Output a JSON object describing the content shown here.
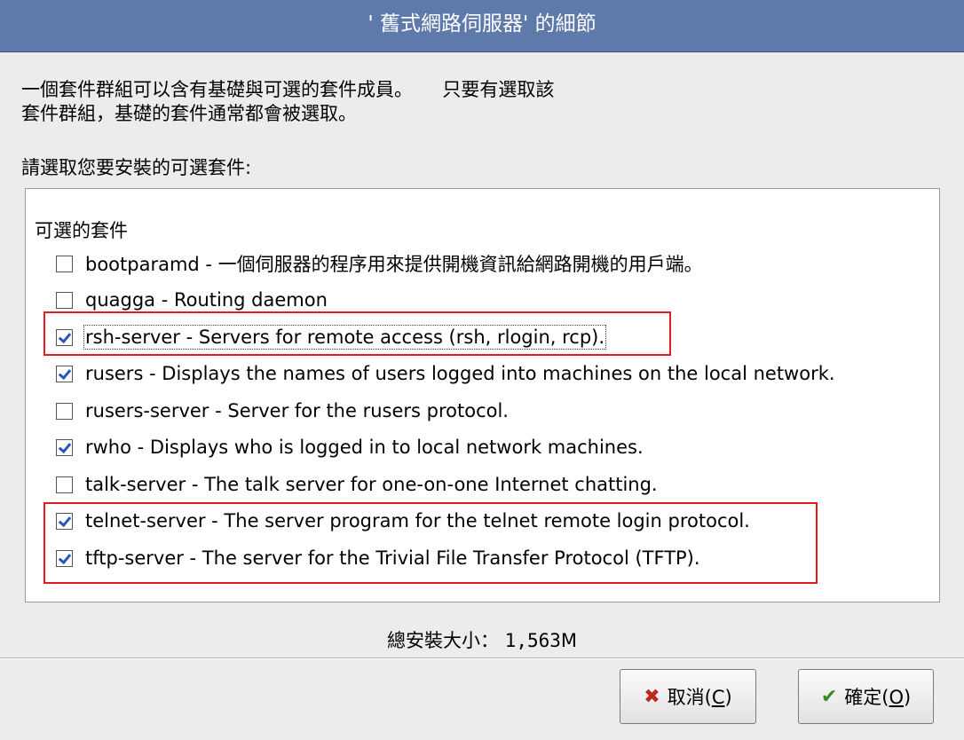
{
  "window": {
    "title": "' 舊式網路伺服器'  的細節"
  },
  "intro": {
    "line1": "一個套件群組可以含有基礎與可選的套件成員。     只要有選取該",
    "line2": "套件群組，基礎的套件通常都會被選取。"
  },
  "prompt": "請選取您要安裝的可選套件:",
  "packages": {
    "group_label": "可選的套件",
    "items": [
      {
        "label": "bootparamd - 一個伺服器的程序用來提供開機資訊給網路開機的用戶端。",
        "checked": false
      },
      {
        "label": "quagga - Routing daemon",
        "checked": false
      },
      {
        "label": "rsh-server - Servers for remote access (rsh, rlogin, rcp).",
        "checked": true
      },
      {
        "label": "rusers - Displays the names of users logged into machines on the local network.",
        "checked": true
      },
      {
        "label": "rusers-server - Server for the rusers protocol.",
        "checked": false
      },
      {
        "label": "rwho - Displays who is logged in to local network machines.",
        "checked": true
      },
      {
        "label": "talk-server - The talk server for one-on-one Internet chatting.",
        "checked": false
      },
      {
        "label": "telnet-server - The server program for the telnet remote login protocol.",
        "checked": true
      },
      {
        "label": "tftp-server - The server for the Trivial File Transfer Protocol (TFTP).",
        "checked": true
      }
    ]
  },
  "total": {
    "label": "總安裝大小：",
    "value": "1,563",
    "unit": "M"
  },
  "buttons": {
    "cancel_text": "取消(",
    "cancel_key": "C",
    "cancel_close": ")",
    "ok_text": "確定(",
    "ok_key": "O",
    "ok_close": ")"
  },
  "colors": {
    "titlebar": "#5e7aab",
    "highlight": "#e41b23",
    "check": "#2b56b8"
  },
  "icons": {
    "cancel": "red-x-icon",
    "ok": "green-check-icon"
  }
}
